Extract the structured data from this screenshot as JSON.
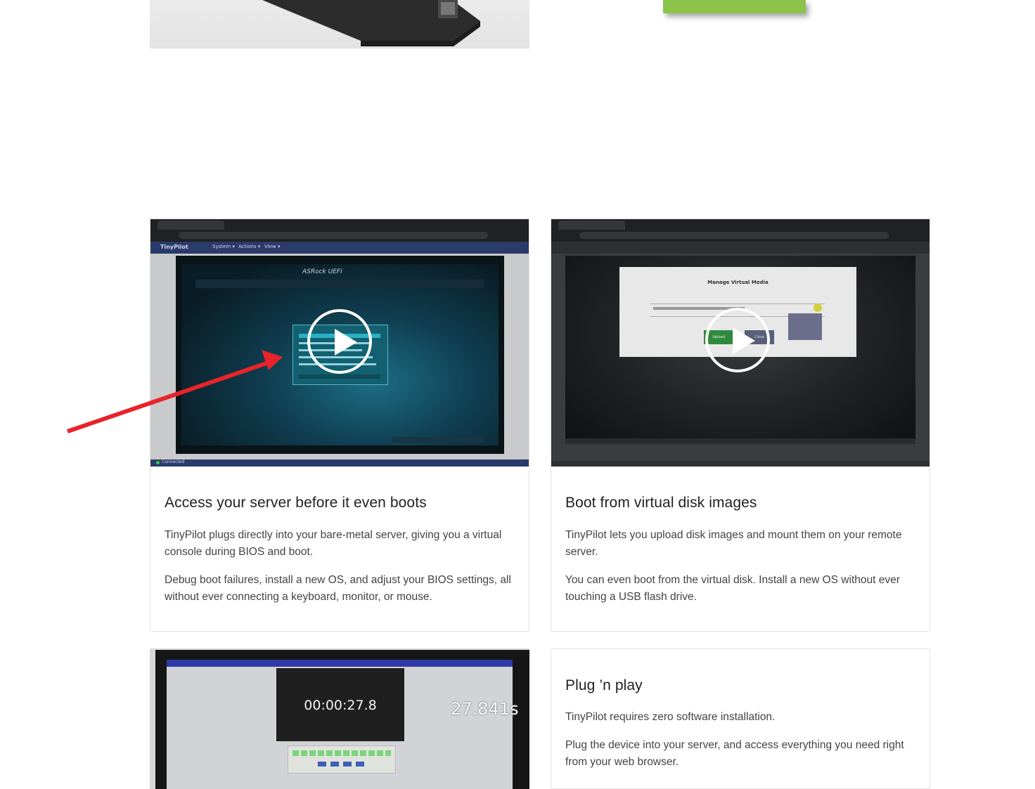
{
  "hero": {
    "photo_alt": "TinyPilot device photo",
    "cta_color": "#8bc34a"
  },
  "features": [
    {
      "title": "Access your server before it even boots",
      "paragraphs": [
        "TinyPilot plugs directly into your bare-metal server, giving you a virtual console during BIOS and boot.",
        "Debug boot failures, install a new OS, and adjust your BIOS settings, all without ever connecting a keyboard, monitor, or mouse."
      ],
      "video": {
        "nav_brand": "TinyPilot",
        "nav_items": [
          "System ▾",
          "Actions ▾",
          "View ▾"
        ],
        "status": "Connected",
        "screen_heading": "ASRock UEFI"
      }
    },
    {
      "title": "Boot from virtual disk images",
      "paragraphs": [
        "TinyPilot lets you upload disk images and mount them on your remote server.",
        "You can even boot from the virtual disk. Install a new OS without ever touching a USB flash drive."
      ],
      "video": {
        "dialog_title": "Manage Virtual Media",
        "upload_label": "Upload",
        "close_label": "Close"
      }
    },
    {
      "title": "Plug ’n play",
      "paragraphs": [
        "TinyPilot requires zero software installation.",
        "Plug the device into your server, and access everything you need right from your web browser."
      ]
    }
  ],
  "latency_demo": {
    "timer": "00:00:27.8",
    "measured": "27.841s"
  },
  "colors": {
    "accent_green": "#8bc34a",
    "arrow_red": "#e8232a",
    "nav_blue": "#2a3a6a"
  }
}
